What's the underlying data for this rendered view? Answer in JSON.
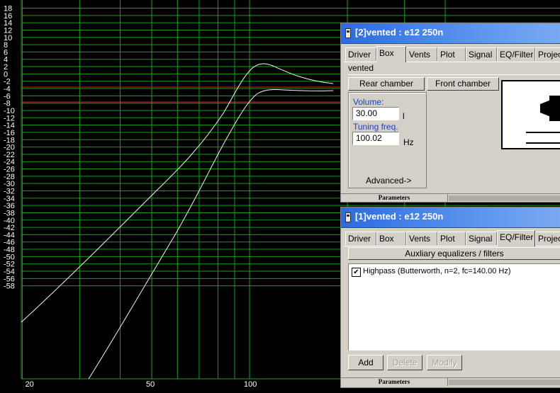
{
  "graph": {
    "y_labels": [
      "18",
      "16",
      "14",
      "12",
      "10",
      "8",
      "6",
      "4",
      "2",
      "0",
      "-2",
      "-4",
      "-6",
      "-8",
      "-10",
      "-12",
      "-14",
      "-16",
      "-18",
      "-20",
      "-22",
      "-24",
      "-26",
      "-28",
      "-30",
      "-32",
      "-34",
      "-36",
      "-38",
      "-40",
      "-42",
      "-44",
      "-46",
      "-48",
      "-50",
      "-52",
      "-54",
      "-56",
      "-58"
    ],
    "x_labels": [
      "20",
      "50",
      "100"
    ],
    "colors": {
      "background": "#000000",
      "grid": "#17a017",
      "reference_line": "#d0202a",
      "curve": "#ffffff"
    }
  },
  "window2": {
    "title": "[2]vented :  e12 250n",
    "tabs": [
      "Driver",
      "Box",
      "Vents",
      "Plot",
      "Signal",
      "EQ/Filter",
      "Project"
    ],
    "selected_tab": "Box",
    "box_name": "vented",
    "rear_chamber_label": "Rear chamber",
    "front_chamber_label": "Front chamber",
    "volume_label": "Volume:",
    "volume_value": "30.00",
    "volume_unit": "l",
    "tuning_label": "Tuning freq.",
    "tuning_value": "100.02",
    "tuning_unit": "Hz",
    "advanced_label": "Advanced->",
    "status_label": "Parameters"
  },
  "window1": {
    "title": "[1]vented :  e12 250n",
    "tabs": [
      "Driver",
      "Box",
      "Vents",
      "Plot",
      "Signal",
      "EQ/Filter",
      "Project"
    ],
    "selected_tab": "EQ/Filter",
    "aux_header": "Auxliary equalizers / filters",
    "filters": [
      {
        "checked": true,
        "label": "Highpass (Butterworth, n=2, fc=140.00 Hz)"
      }
    ],
    "add_label": "Add",
    "delete_label": "Delete",
    "modify_label": "Modify",
    "status_label": "Parameters"
  }
}
